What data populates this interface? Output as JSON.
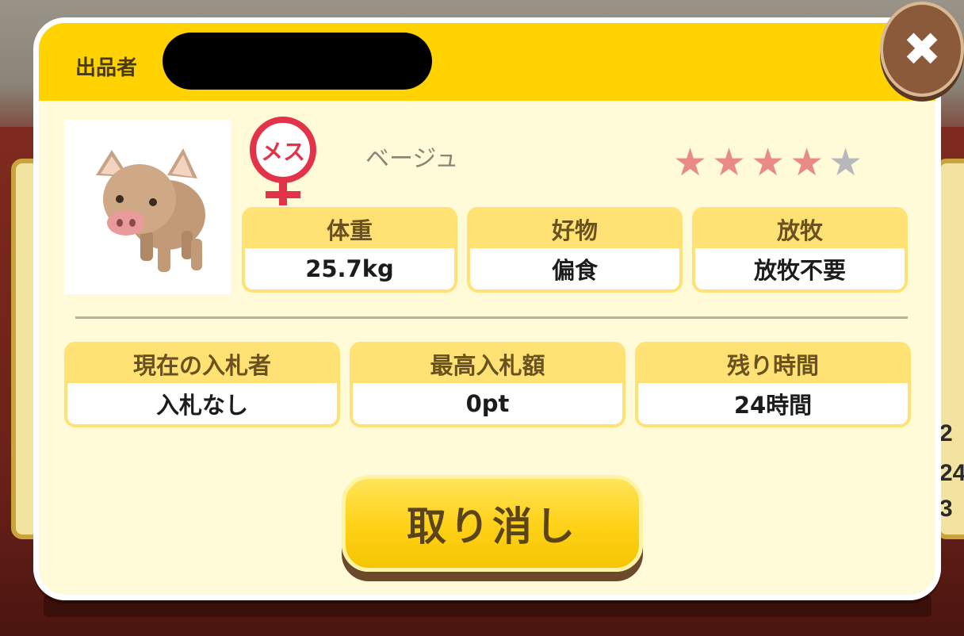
{
  "header": {
    "seller_label": "出品者"
  },
  "pet": {
    "image": "pig-icon",
    "gender_icon": "female-icon",
    "gender_label": "メス",
    "color_name": "ベージュ",
    "rating": {
      "value": 4,
      "max": 5
    }
  },
  "stats": [
    {
      "title": "体重",
      "value": "25.7kg"
    },
    {
      "title": "好物",
      "value": "偏食"
    },
    {
      "title": "放牧",
      "value": "放牧不要"
    }
  ],
  "auction": [
    {
      "title": "現在の入札者",
      "value": "入札なし"
    },
    {
      "title": "最高入札額",
      "value": "0pt"
    },
    {
      "title": "残り時間",
      "value": "24時間"
    }
  ],
  "buttons": {
    "cancel_label": "取り消し",
    "close_icon": "close-icon"
  },
  "background": {
    "peek_values": [
      "2",
      "24",
      "3"
    ]
  },
  "colors": {
    "header": "#ffd200",
    "panel": "#fffbd8",
    "star_on": "#e88a86",
    "star_off": "#b8b8bc",
    "gender": "#e2334a"
  }
}
